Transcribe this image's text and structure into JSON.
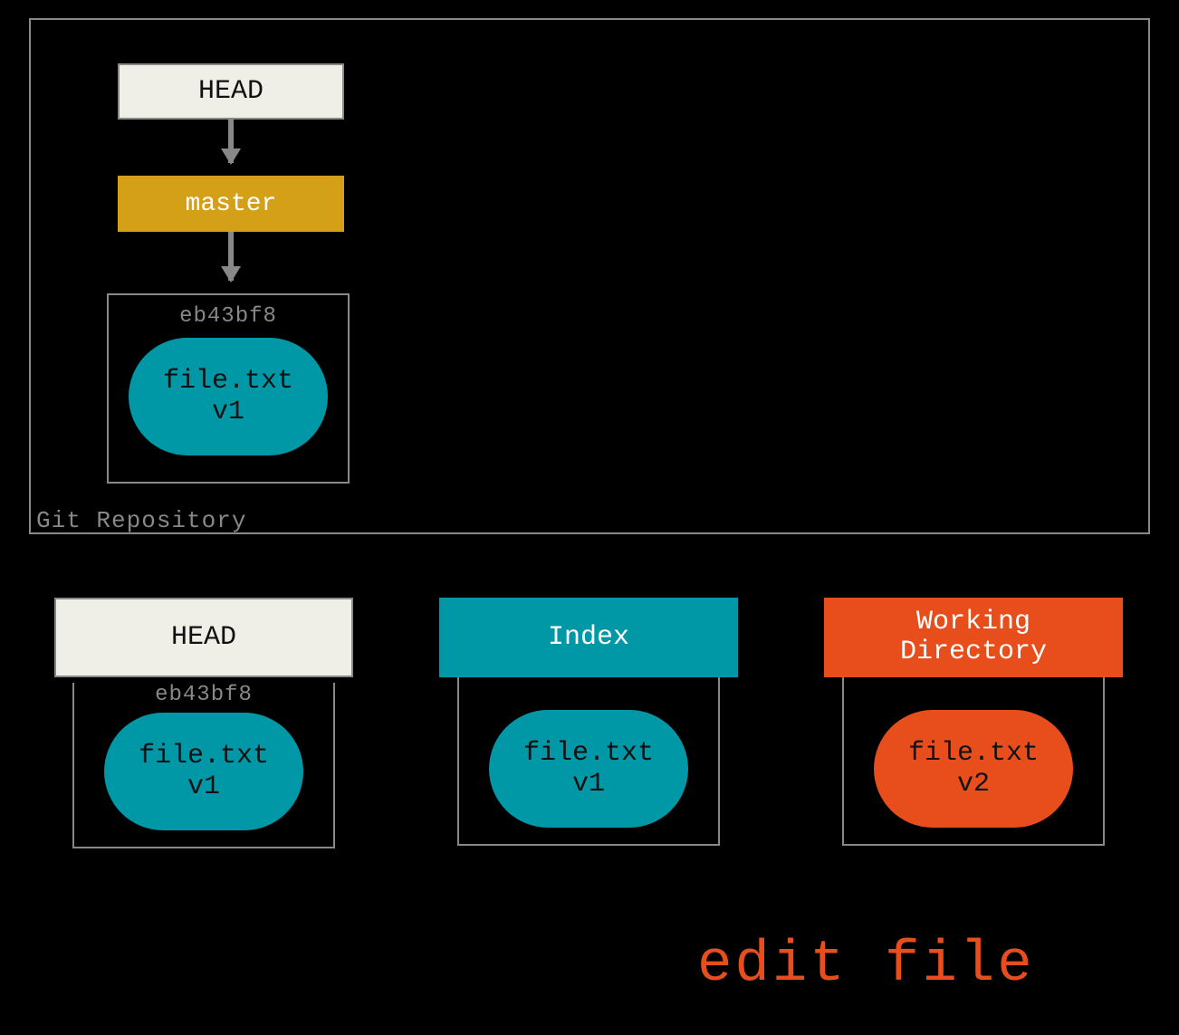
{
  "repo": {
    "label": "Git Repository",
    "head_label": "HEAD",
    "branch_label": "master",
    "commit": {
      "hash": "eb43bf8",
      "file": "file.txt",
      "version": "v1"
    }
  },
  "trees": {
    "head": {
      "title": "HEAD",
      "hash": "eb43bf8",
      "file": "file.txt",
      "version": "v1"
    },
    "index": {
      "title": "Index",
      "file": "file.txt",
      "version": "v1"
    },
    "working": {
      "title": "Working Directory",
      "file": "file.txt",
      "version": "v2"
    }
  },
  "action_label": "edit file",
  "colors": {
    "teal": "#0097a7",
    "orange": "#e84e1c",
    "gold": "#d4a017",
    "cream": "#f0efe7",
    "grey": "#888888"
  }
}
